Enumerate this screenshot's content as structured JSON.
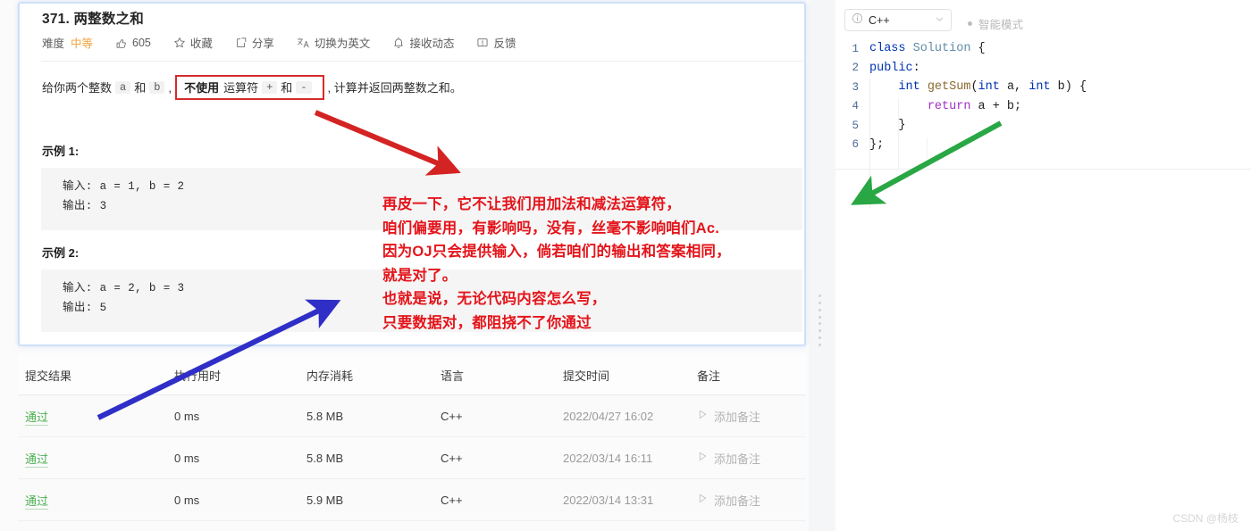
{
  "problem": {
    "title": "371. 两整数之和",
    "meta": {
      "difficulty_label": "难度",
      "difficulty_value": "中等",
      "likes": "605",
      "favorite": "收藏",
      "share": "分享",
      "switch_lang": "切换为英文",
      "subscribe": "接收动态",
      "feedback": "反馈"
    },
    "description": {
      "part1": "给你两个整数",
      "var_a": "a",
      "and1": "和",
      "var_b": "b",
      "comma": ",",
      "boxed_strong": "不使用",
      "boxed_text": "运算符",
      "op_plus": "+",
      "and2": "和",
      "op_minus": "-",
      "part2": ", 计算并返回两整数之和。"
    },
    "examples": [
      {
        "heading": "示例 1:",
        "input": "输入: a = 1, b = 2",
        "output": "输出: 3"
      },
      {
        "heading": "示例 2:",
        "input": "输入: a = 2, b = 3",
        "output": "输出: 5"
      }
    ]
  },
  "submissions": {
    "columns": [
      "提交结果",
      "执行用时",
      "内存消耗",
      "语言",
      "提交时间",
      "备注"
    ],
    "rows": [
      {
        "result": "通过",
        "runtime": "0 ms",
        "memory": "5.8 MB",
        "language": "C++",
        "time": "2022/04/27 16:02",
        "note": "添加备注"
      },
      {
        "result": "通过",
        "runtime": "0 ms",
        "memory": "5.8 MB",
        "language": "C++",
        "time": "2022/03/14 16:11",
        "note": "添加备注"
      },
      {
        "result": "通过",
        "runtime": "0 ms",
        "memory": "5.9 MB",
        "language": "C++",
        "time": "2022/03/14 13:31",
        "note": "添加备注"
      }
    ]
  },
  "editor": {
    "language": "C++",
    "smart_mode": "智能模式",
    "lines": [
      {
        "n": "1",
        "tokens": [
          {
            "t": "class ",
            "c": "k"
          },
          {
            "t": "Solution",
            "c": "ty"
          },
          {
            "t": " {",
            "c": "pl"
          }
        ]
      },
      {
        "n": "2",
        "tokens": [
          {
            "t": "public",
            "c": "k"
          },
          {
            "t": ":",
            "c": "pl"
          }
        ]
      },
      {
        "n": "3",
        "tokens": [
          {
            "t": "    ",
            "c": "pl"
          },
          {
            "t": "int",
            "c": "k"
          },
          {
            "t": " ",
            "c": "pl"
          },
          {
            "t": "getSum",
            "c": "fn"
          },
          {
            "t": "(",
            "c": "pl"
          },
          {
            "t": "int",
            "c": "k"
          },
          {
            "t": " a, ",
            "c": "pl"
          },
          {
            "t": "int",
            "c": "k"
          },
          {
            "t": " b) {",
            "c": "pl"
          }
        ]
      },
      {
        "n": "4",
        "tokens": [
          {
            "t": "        ",
            "c": "pl"
          },
          {
            "t": "return",
            "c": "kp"
          },
          {
            "t": " a + b;",
            "c": "pl"
          }
        ]
      },
      {
        "n": "5",
        "tokens": [
          {
            "t": "    }",
            "c": "pl"
          }
        ]
      },
      {
        "n": "6",
        "tokens": [
          {
            "t": "};",
            "c": "pl"
          }
        ]
      }
    ]
  },
  "annotation": {
    "text": "再皮一下，它不让我们用加法和减法运算符，\n咱们偏要用，有影响吗，没有，丝毫不影响咱们Ac.\n因为OJ只会提供输入，倘若咱们的输出和答案相同，\n就是对了。\n也就是说，无论代码内容怎么写，\n只要数据对，都阻挠不了你通过",
    "colors": {
      "red": "#e4151b",
      "blue": "#2b2bc8",
      "green": "#22a martin"
    }
  },
  "watermark": "CSDN @杨枝",
  "colors": {
    "arrow_red": "#d42323",
    "arrow_blue": "#2f2fc7",
    "arrow_green": "#29a745",
    "pass_green": "#4caf50",
    "difficulty_orange": "#efa33e",
    "card_border_blue": "#cfe0f7"
  }
}
